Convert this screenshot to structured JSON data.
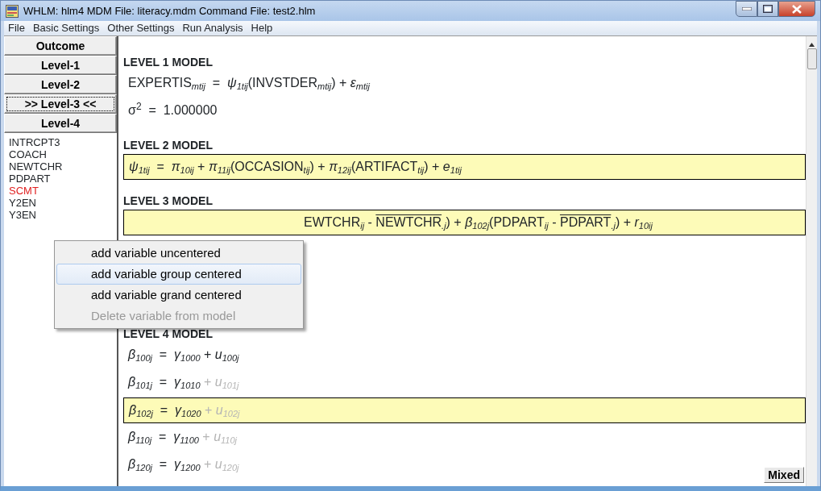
{
  "window": {
    "title": "WHLM: hlm4 MDM File: literacy.mdm   Command File: test2.hlm"
  },
  "menu": [
    "File",
    "Basic Settings",
    "Other Settings",
    "Run Analysis",
    "Help"
  ],
  "level_buttons": [
    {
      "label": "Outcome",
      "selected": false
    },
    {
      "label": "Level-1",
      "selected": false
    },
    {
      "label": "Level-2",
      "selected": false
    },
    {
      "label": ">> Level-3 <<",
      "selected": true
    },
    {
      "label": "Level-4",
      "selected": false
    }
  ],
  "variables": [
    {
      "name": "INTRCPT3",
      "in_model": false
    },
    {
      "name": "COACH",
      "in_model": false
    },
    {
      "name": "NEWTCHR",
      "in_model": false
    },
    {
      "name": "PDPART",
      "in_model": false
    },
    {
      "name": "SCMT",
      "in_model": true
    },
    {
      "name": "Y2EN",
      "in_model": false
    },
    {
      "name": "Y3EN",
      "in_model": false
    }
  ],
  "context_menu": [
    {
      "label": "add variable uncentered",
      "selected": false,
      "disabled": false
    },
    {
      "label": "add variable group centered",
      "selected": true,
      "disabled": false
    },
    {
      "label": "add variable grand centered",
      "selected": false,
      "disabled": false
    },
    {
      "label": "Delete variable from model",
      "selected": false,
      "disabled": true
    }
  ],
  "sections": [
    {
      "heading": "LEVEL 1 MODEL",
      "equations": [
        {
          "selected": false,
          "parts": [
            {
              "kind": "plain",
              "text": "EXPERTIS$_{mtij}$  =  *ψ*$_{1tij}$(INVSTDER$_{mtij}$) + *ε*$_{mtij}$"
            }
          ]
        },
        {
          "selected": false,
          "parts": [
            {
              "kind": "plain",
              "text": "σ$^{2}$  =  1.000000"
            }
          ]
        }
      ]
    },
    {
      "heading": "LEVEL 2 MODEL",
      "equations": [
        {
          "selected": true,
          "parts": [
            {
              "kind": "plain",
              "text": "*ψ*$_{1tij}$  =  *π*$_{10ij}$ + *π*$_{11ij}$(OCCASION$_{tij}$) + *π*$_{12ij}$(ARTIFACT$_{tij}$) + *e*$_{1tij}$"
            }
          ]
        }
      ]
    },
    {
      "heading": "LEVEL 3 MODEL",
      "equations": [
        {
          "selected": true,
          "covered": true,
          "parts": [
            {
              "kind": "plain",
              "text": "EWTCHR$_{ij}$ - "
            },
            {
              "kind": "bar",
              "text": "NEWTCHR"
            },
            {
              "kind": "plain",
              "text": "$_{.j}$) + *β*$_{102j}$(PDPART$_{ij}$ - "
            },
            {
              "kind": "bar",
              "text": "PDPART"
            },
            {
              "kind": "plain",
              "text": "$_{.j}$) + *r*$_{10ij}$"
            }
          ]
        }
      ]
    },
    {
      "heading": "LEVEL 4 MODEL",
      "equations": [
        {
          "selected": false,
          "parts": [
            {
              "kind": "plain",
              "text": "*β*$_{100j}$  =  *γ*$_{1000}$ + *u*$_{100j}$"
            }
          ]
        },
        {
          "selected": false,
          "parts": [
            {
              "kind": "plain",
              "text": "*β*$_{101j}$  =  *γ*$_{1010}$ "
            },
            {
              "kind": "faded",
              "text": "+ *u*$_{101j}$"
            }
          ]
        },
        {
          "selected": true,
          "parts": [
            {
              "kind": "plain",
              "text": "*β*$_{102j}$  =  *γ*$_{1020}$ "
            },
            {
              "kind": "faded",
              "text": "+ *u*$_{102j}$"
            }
          ]
        },
        {
          "selected": false,
          "parts": [
            {
              "kind": "plain",
              "text": "*β*$_{110j}$  =  *γ*$_{1100}$ "
            },
            {
              "kind": "faded",
              "text": "+ *u*$_{110j}$"
            }
          ]
        },
        {
          "selected": false,
          "parts": [
            {
              "kind": "plain",
              "text": "*β*$_{120j}$  =  *γ*$_{1200}$ "
            },
            {
              "kind": "faded",
              "text": "+ *u*$_{120j}$"
            }
          ]
        }
      ]
    }
  ],
  "mode_button": "Mixed"
}
